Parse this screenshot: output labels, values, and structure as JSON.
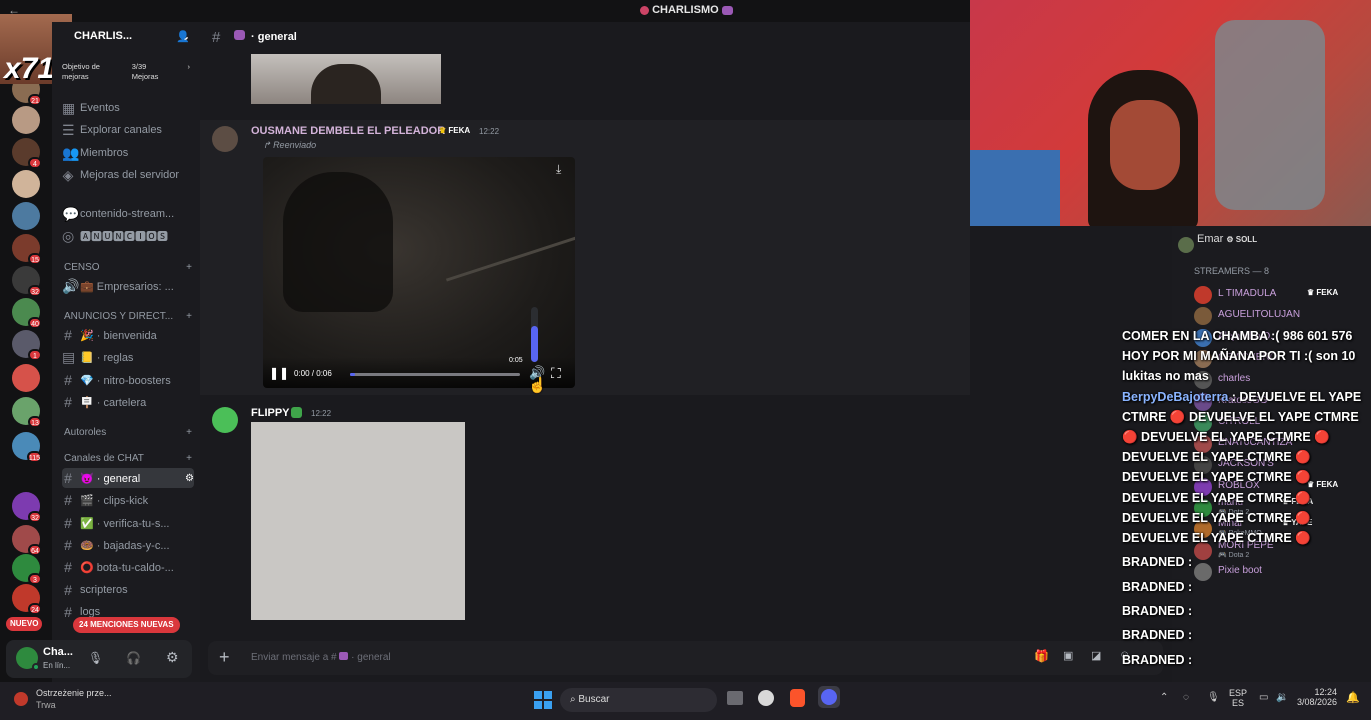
{
  "window": {
    "title": "CHARLISMO"
  },
  "stream_overlay": {
    "logo_text": "x711"
  },
  "server": {
    "name": "CHARLIS...",
    "boost_goal_label": "Objetivo de mejoras",
    "boost_progress": "3/39 Mejoras"
  },
  "server_rail_badges": [
    "21",
    "4",
    "15",
    "32",
    "40",
    "1",
    "13",
    "115",
    "32",
    "64",
    "3",
    "24"
  ],
  "nav_items": [
    {
      "label": "Eventos",
      "icon": "calendar-icon"
    },
    {
      "label": "Explorar canales",
      "icon": "list-icon"
    },
    {
      "label": "Miembros",
      "icon": "members-icon"
    },
    {
      "label": "Mejoras del servidor",
      "icon": "boost-icon"
    }
  ],
  "extra_channels": [
    {
      "label": "contenido-stream..."
    },
    {
      "label": "🅰🅽🆄🅽🅲🅸🅾🆂"
    }
  ],
  "categories": {
    "censo": "CENSO",
    "anuncios": "ANUNCIOS Y DIRECT...",
    "autoroles": "Autoroles",
    "chat": "Canales de CHAT"
  },
  "censo_channels": [
    {
      "label": "💼 Empresarios: ..."
    }
  ],
  "anuncios_channels": [
    {
      "label": "🎉 · bienvenida"
    },
    {
      "label": "📒 · reglas"
    },
    {
      "label": "💎 · nitro-boosters"
    },
    {
      "label": "🪧 · cartelera"
    }
  ],
  "chat_channels": [
    {
      "label": "😈 · general",
      "selected": true
    },
    {
      "label": "🎬 · clips-kick"
    },
    {
      "label": "✅ · verifica-tu-s..."
    },
    {
      "label": "🍩 · bajadas-y-c..."
    },
    {
      "label": "⭕ bota-tu-caldo-..."
    },
    {
      "label": "scripteros"
    },
    {
      "label": "logs"
    }
  ],
  "pills": {
    "nuevo": "NUEVO",
    "mentions": "24 MENCIONES NUEVAS"
  },
  "user_panel": {
    "name": "Cha...",
    "status": "En lín..."
  },
  "channel_header": {
    "name": "general"
  },
  "messages": [
    {
      "author": "OUSMANE DEMBELE EL PELEADOR",
      "tag": "FEKA",
      "time": "12:22",
      "forwarded": "Reenviado",
      "video": {
        "current": "0:00",
        "duration": "0:06",
        "hover_time": "0:05",
        "progress": 0.03,
        "volume": 0.65
      }
    },
    {
      "author": "FLIPPY",
      "time": "12:22"
    }
  ],
  "composer": {
    "placeholder": "Enviar mensaje a #",
    "channel": "general"
  },
  "members": {
    "top": {
      "name": "Emar",
      "tag": "SOLL"
    },
    "section": "STREAMERS — 8",
    "list": [
      {
        "name": "L TIMADULA",
        "tag": "FEKA"
      },
      {
        "name": "AGUELITOLUJAN"
      },
      {
        "name": "Alejandro D."
      },
      {
        "name": "CEVICHERO"
      },
      {
        "name": "charles"
      },
      {
        "name": "KratossGG"
      },
      {
        "name": "CITROLL"
      },
      {
        "name": "ENAT0CANTIZA"
      },
      {
        "name": "JACKSON'S"
      },
      {
        "name": "ROBLOX",
        "tag": "FEKA"
      },
      {
        "name": "manu",
        "activity": "Dota 2",
        "tag": "FEKA"
      },
      {
        "name": "Minar",
        "activity": "PokeMMO",
        "tag": "YAPE"
      },
      {
        "name": "MORI PEPE",
        "activity": "Dota 2"
      },
      {
        "name": "Pixie boot"
      }
    ]
  },
  "chat_overlay": {
    "lines": [
      "COMER EN LA CHAMBA :( 986 601 576 HOY POR MI MAÑANA POR TI :( son 10 lukitas no mas",
      "DEVUELVE EL YAPE CTMRE 🔴 DEVUELVE EL YAPE CTMRE 🔴 DEVUELVE EL YAPE CTMRE 🔴 DEVUELVE EL YAPE CTMRE 🔴 DEVUELVE EL YAPE CTMRE 🔴 DEVUELVE EL YAPE CTMRE 🔴 DEVUELVE EL YAPE CTMRE 🔴 DEVUELVE EL YAPE CTMRE 🔴"
    ],
    "author": "BerpyDeBajoterra",
    "bradned": [
      "BRADNED :",
      "BRADNED :",
      "BRADNED :",
      "BRADNED :",
      "BRADNED :"
    ]
  },
  "taskbar": {
    "notification_title": "Ostrzeżenie prze...",
    "notification_sub": "Trwa",
    "search": "Buscar",
    "lang1": "ESP",
    "lang2": "ES",
    "time": "12:24",
    "date": "3/08/2026"
  },
  "colors": {
    "accent": "#5865f2",
    "mention_red": "#da373c",
    "online": "#23a55a",
    "background": "#1a1a1e"
  }
}
